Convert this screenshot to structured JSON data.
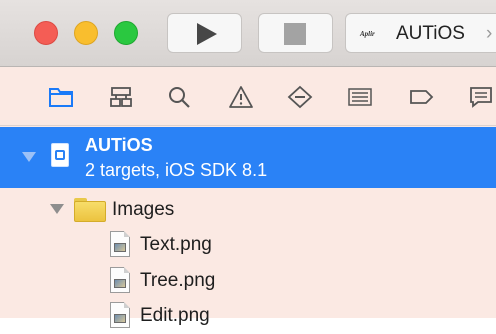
{
  "toolbar": {
    "traffic_lights": [
      "close",
      "minimize",
      "zoom"
    ],
    "run_icon": "play-icon",
    "stop_icon": "stop-icon",
    "scheme_label": "AUTiOS",
    "scheme_chevron": "›",
    "scheme_icon_text": "Aplir"
  },
  "navigator_tabs": [
    {
      "icon": "folder-icon",
      "active": true
    },
    {
      "icon": "hierarchy-icon"
    },
    {
      "icon": "search-icon"
    },
    {
      "icon": "warning-icon"
    },
    {
      "icon": "test-diamond-icon"
    },
    {
      "icon": "debug-list-icon"
    },
    {
      "icon": "breakpoint-icon"
    },
    {
      "icon": "report-icon"
    }
  ],
  "project": {
    "name": "AUTiOS",
    "subtitle": "2 targets, iOS SDK 8.1"
  },
  "tree": {
    "group": "Images",
    "files": [
      "Text.png",
      "Tree.png",
      "Edit.png"
    ]
  },
  "colors": {
    "selection": "#2a82f6",
    "sidebar_bg": "#fbe9e3",
    "active_tab": "#1a7af8"
  }
}
